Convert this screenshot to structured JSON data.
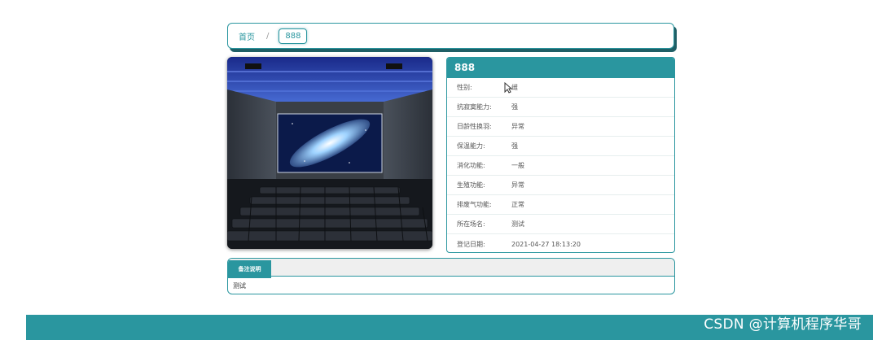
{
  "breadcrumb": {
    "home": "首页",
    "separator": "/",
    "current": "888"
  },
  "detail": {
    "title": "888",
    "rows": [
      {
        "label": "性别:",
        "value": "雌"
      },
      {
        "label": "抗寂寞能力:",
        "value": "强"
      },
      {
        "label": "日龄性换羽:",
        "value": "异常"
      },
      {
        "label": "保温能力:",
        "value": "强"
      },
      {
        "label": "消化功能:",
        "value": "一般"
      },
      {
        "label": "生殖功能:",
        "value": "异常"
      },
      {
        "label": "排废气功能:",
        "value": "正常"
      },
      {
        "label": "所在场名:",
        "value": "测试"
      },
      {
        "label": "登记日期:",
        "value": "2021-04-27 18:13:20"
      }
    ]
  },
  "remark": {
    "tab": "备注说明",
    "content": "测试"
  },
  "watermark": "CSDN @计算机程序华哥",
  "colors": {
    "accent": "#2a969f",
    "shadow": "#1f5f66"
  },
  "icons": {
    "cursor": "mouse-pointer-icon",
    "photo": "cinema-hall-image"
  }
}
